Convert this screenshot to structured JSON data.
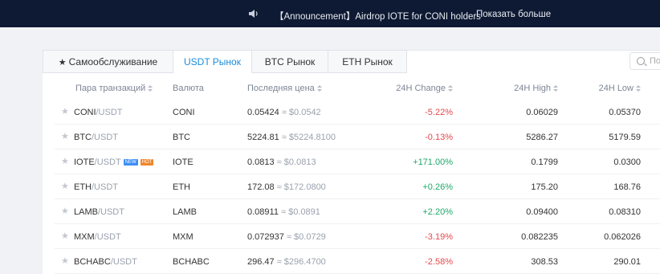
{
  "topbar": {
    "announcement": "【Announcement】Airdrop IOTE for CONI holders",
    "more_link": "Показать больше",
    "icon": "speaker-icon"
  },
  "tabs": [
    {
      "label": "Самообслуживание",
      "icon": "star-icon",
      "active": false
    },
    {
      "label": "USDT Рынок",
      "active": true
    },
    {
      "label": "BTC Рынок",
      "active": false
    },
    {
      "label": "ETH Рынок",
      "active": false
    }
  ],
  "search": {
    "placeholder": "По",
    "icon": "search-icon"
  },
  "columns": {
    "pair": "Пара транзакций",
    "currency": "Валюта",
    "last_price": "Последняя цена",
    "change": "24H Change",
    "high": "24H High",
    "low": "24H Low"
  },
  "rows": [
    {
      "base": "CONI",
      "quote": "/USDT",
      "currency": "CONI",
      "price": "0.05424",
      "approx": " ≈ $0.0542",
      "change": "-5.22%",
      "direction": "down",
      "high": "0.06029",
      "low": "0.05370",
      "badges": []
    },
    {
      "base": "BTC",
      "quote": "/USDT",
      "currency": "BTC",
      "price": "5224.81",
      "approx": " ≈ $5224.8100",
      "change": "-0.13%",
      "direction": "down",
      "high": "5286.27",
      "low": "5179.59",
      "badges": []
    },
    {
      "base": "IOTE",
      "quote": "/USDT",
      "currency": "IOTE",
      "price": "0.0813",
      "approx": " ≈ $0.0813",
      "change": "+171.00%",
      "direction": "up",
      "high": "0.1799",
      "low": "0.0300",
      "badges": [
        {
          "text": "NEW",
          "color": "#3e8ef7"
        },
        {
          "text": "HOT",
          "color": "#f0872b"
        }
      ]
    },
    {
      "base": "ETH",
      "quote": "/USDT",
      "currency": "ETH",
      "price": "172.08",
      "approx": " ≈ $172.0800",
      "change": "+0.26%",
      "direction": "up",
      "high": "175.20",
      "low": "168.76",
      "badges": []
    },
    {
      "base": "LAMB",
      "quote": "/USDT",
      "currency": "LAMB",
      "price": "0.08911",
      "approx": " ≈ $0.0891",
      "change": "+2.20%",
      "direction": "up",
      "high": "0.09400",
      "low": "0.08310",
      "badges": []
    },
    {
      "base": "MXM",
      "quote": "/USDT",
      "currency": "MXM",
      "price": "0.072937",
      "approx": " ≈ $0.0729",
      "change": "-3.19%",
      "direction": "down",
      "high": "0.082235",
      "low": "0.062026",
      "badges": []
    },
    {
      "base": "BCHABC",
      "quote": "/USDT",
      "currency": "BCHABC",
      "price": "296.47",
      "approx": " ≈ $296.4700",
      "change": "-2.58%",
      "direction": "down",
      "high": "308.53",
      "low": "290.01",
      "badges": []
    }
  ],
  "colors": {
    "accent": "#1a8cd8",
    "positive": "#1fa86a",
    "negative": "#e5484d",
    "topbar": "#0e1a33"
  }
}
